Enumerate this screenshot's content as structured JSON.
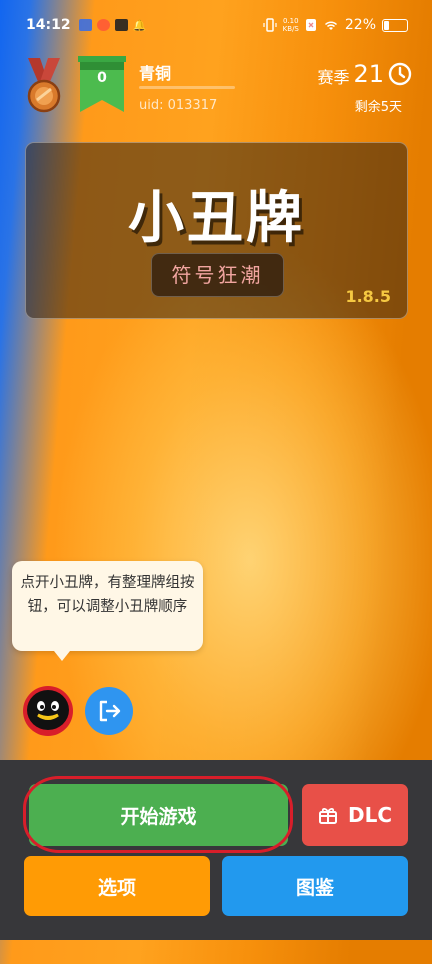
{
  "status_bar": {
    "time": "14:12",
    "net_speed_value": "0.10",
    "net_speed_unit": "KB/S",
    "battery": "22%",
    "battery_level": 0.22
  },
  "profile": {
    "rank_number": "0",
    "rank_name": "青铜",
    "rank_progress": 0,
    "uid": "uid: 013317",
    "season_label": "赛季",
    "season_number": "21",
    "remaining": "剩余5天"
  },
  "title_card": {
    "title": "小丑牌",
    "subtitle": "符号狂潮",
    "version": "1.8.5"
  },
  "tip": {
    "text": "点开小丑牌，有整理牌组按钮，可以调整小丑牌顺序"
  },
  "buttons": {
    "start": "开始游戏",
    "dlc": "DLC",
    "options": "选项",
    "gallery": "图鉴"
  },
  "colors": {
    "start_green": "#4caf50",
    "dlc_red": "#e85048",
    "options_orange": "#ff9b05",
    "gallery_blue": "#2299ee",
    "version_yellow": "#f5c842",
    "highlight_ring": "#d81e2a"
  },
  "icons": {
    "medal": "bronze-medal-icon",
    "rank": "rank-flag-icon",
    "clock": "clock-icon",
    "logout": "logout-icon",
    "gift": "gift-icon",
    "qq": "qq-penguin-icon"
  }
}
